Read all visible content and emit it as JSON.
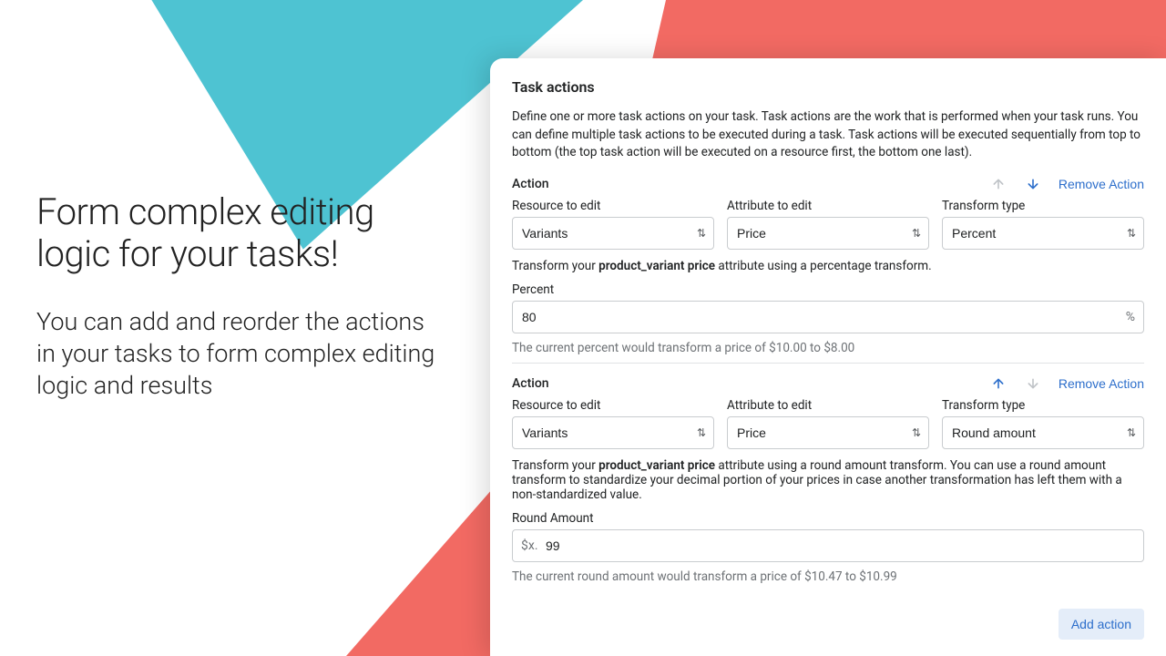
{
  "promo": {
    "headline": "Form complex editing logic for your tasks!",
    "body": "You can add and reorder the actions in your tasks to form complex editing logic and results"
  },
  "panel": {
    "title": "Task actions",
    "description": "Define one or more task actions on your task. Task actions are the work that is performed when your task runs. You can define multiple task actions to be executed during a task. Task actions will be executed sequentially from top to bottom (the top task action will be executed on a resource first, the bottom one last).",
    "action_label": "Action",
    "remove_label": "Remove Action",
    "add_label": "Add action",
    "fields": {
      "resource": "Resource to edit",
      "attribute": "Attribute to edit",
      "transform": "Transform type"
    },
    "actions": [
      {
        "resource": "Variants",
        "attribute": "Price",
        "transform": "Percent",
        "explain_pre": "Transform your ",
        "explain_bold": "product_variant price",
        "explain_post": " attribute using a percentage transform.",
        "value_label": "Percent",
        "value": "80",
        "suffix": "%",
        "hint": "The current percent would transform a price of $10.00 to $8.00"
      },
      {
        "resource": "Variants",
        "attribute": "Price",
        "transform": "Round amount",
        "explain_pre": "Transform your ",
        "explain_bold": "product_variant price",
        "explain_post": " attribute using a round amount transform. You can use a round amount transform to standardize your decimal portion of your prices in case another transformation has left them with a non-standardized value.",
        "value_label": "Round Amount",
        "prefix": "$x.",
        "value": "99",
        "hint": "The current round amount would transform a price of $10.47 to $10.99"
      }
    ]
  }
}
